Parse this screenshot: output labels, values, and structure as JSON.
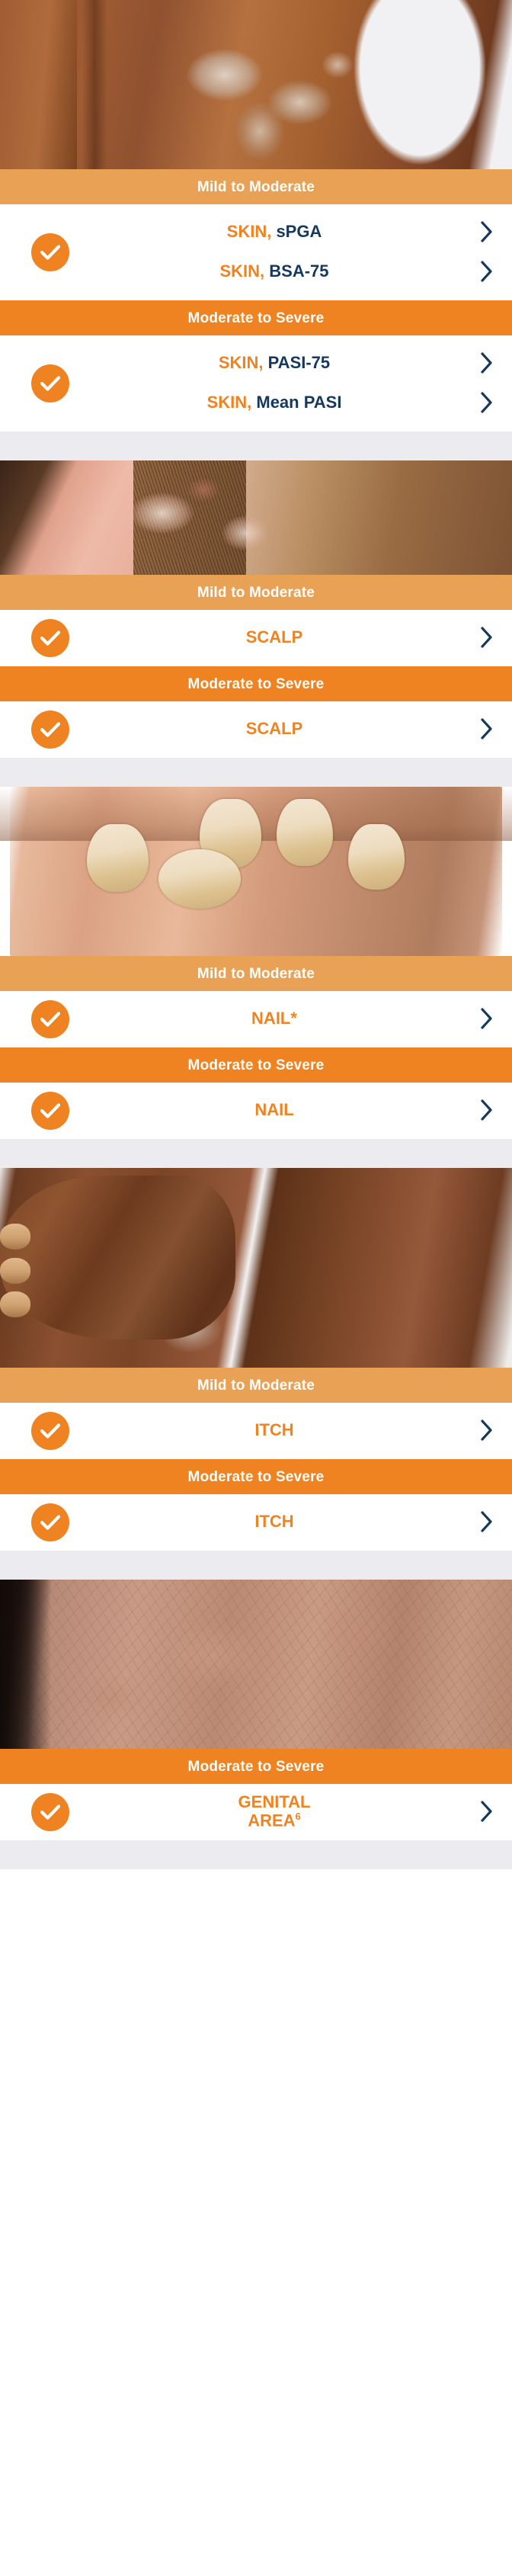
{
  "accent": {
    "orange": "#ef8322",
    "orange_light": "#e9a156",
    "navy": "#15395e",
    "gap_gray": "#ececf0",
    "white": "#ffffff"
  },
  "labels": {
    "mild_to_moderate": "Mild to Moderate",
    "moderate_to_severe": "Moderate to Severe"
  },
  "sections": [
    {
      "id": "skin",
      "photo_alt": "trunk-plaque-psoriasis-photo",
      "groups": [
        {
          "band": "Mild to Moderate",
          "band_style": "mild",
          "rows": [
            {
              "prefix": "SKIN,",
              "suffix": " sPGA",
              "full": "SKIN, sPGA",
              "style": "split"
            },
            {
              "prefix": "SKIN,",
              "suffix": " BSA-75",
              "full": "SKIN, BSA-75",
              "style": "split"
            }
          ]
        },
        {
          "band": "Moderate to Severe",
          "band_style": "severe",
          "rows": [
            {
              "prefix": "SKIN,",
              "suffix": " PASI-75",
              "full": "SKIN, PASI-75",
              "style": "split"
            },
            {
              "prefix": "SKIN,",
              "suffix": " Mean PASI",
              "full": "SKIN, Mean PASI",
              "style": "split"
            }
          ]
        }
      ]
    },
    {
      "id": "scalp",
      "photo_alt": "scalp-hairline-psoriasis-photo",
      "groups": [
        {
          "band": "Mild to Moderate",
          "band_style": "mild",
          "rows": [
            {
              "prefix": "SCALP",
              "suffix": "",
              "full": "SCALP",
              "style": "orange"
            }
          ]
        },
        {
          "band": "Moderate to Severe",
          "band_style": "severe",
          "rows": [
            {
              "prefix": "SCALP",
              "suffix": "",
              "full": "SCALP",
              "style": "orange"
            }
          ]
        }
      ]
    },
    {
      "id": "nail",
      "photo_alt": "fingernail-psoriasis-photo",
      "groups": [
        {
          "band": "Mild to Moderate",
          "band_style": "mild",
          "rows": [
            {
              "prefix": "NAIL*",
              "suffix": "",
              "full": "NAIL*",
              "style": "orange"
            }
          ]
        },
        {
          "band": "Moderate to Severe",
          "band_style": "severe",
          "rows": [
            {
              "prefix": "NAIL",
              "suffix": "",
              "full": "NAIL",
              "style": "orange"
            }
          ]
        }
      ]
    },
    {
      "id": "itch",
      "photo_alt": "elbow-plaque-scratching-photo",
      "groups": [
        {
          "band": "Mild to Moderate",
          "band_style": "mild",
          "rows": [
            {
              "prefix": "ITCH",
              "suffix": "",
              "full": "ITCH",
              "style": "orange"
            }
          ]
        },
        {
          "band": "Moderate to Severe",
          "band_style": "severe",
          "rows": [
            {
              "prefix": "ITCH",
              "suffix": "",
              "full": "ITCH",
              "style": "orange"
            }
          ]
        }
      ]
    },
    {
      "id": "genital",
      "photo_alt": "genital-area-psoriasis-photo",
      "groups": [
        {
          "band": "Moderate to Severe",
          "band_style": "severe",
          "rows": [
            {
              "prefix": "GENITAL AREA",
              "suffix": "",
              "full": "GENITAL AREA",
              "superscript": "6",
              "style": "orange-two-line",
              "line1": "GENITAL",
              "line2": "AREA"
            }
          ]
        }
      ]
    }
  ],
  "icons": {
    "check": "check-icon",
    "chevron": "chevron-right-icon"
  }
}
